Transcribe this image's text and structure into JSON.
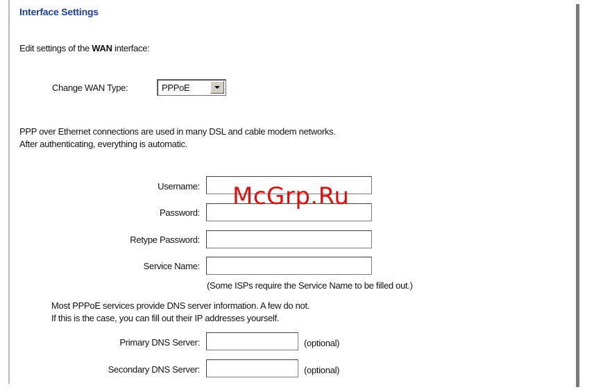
{
  "header": {
    "title": "Interface Settings"
  },
  "intro": {
    "before": "Edit settings of the ",
    "bold": "WAN",
    "after": " interface:"
  },
  "wan_type": {
    "label": "Change WAN Type:",
    "selected": "PPPoE"
  },
  "description": {
    "line1": "PPP over Ethernet connections are used in many DSL and cable modem networks.",
    "line2": "After authenticating, everything is automatic."
  },
  "form": {
    "username_label": "Username:",
    "username_value": "",
    "password_label": "Password:",
    "password_value": "",
    "retype_label": "Retype Password:",
    "retype_value": "",
    "service_label": "Service Name:",
    "service_value": "",
    "service_note": "(Some ISPs require the Service Name to be filled out.)"
  },
  "dns": {
    "line1": "Most PPPoE services provide DNS server information. A few do not.",
    "line2": "If this is the case, you can fill out their IP addresses yourself.",
    "primary_label": "Primary DNS Server:",
    "primary_value": "",
    "secondary_label": "Secondary DNS Server:",
    "secondary_value": "",
    "optional_note": "(optional)"
  },
  "watermark": {
    "text": "McGrp.Ru"
  }
}
